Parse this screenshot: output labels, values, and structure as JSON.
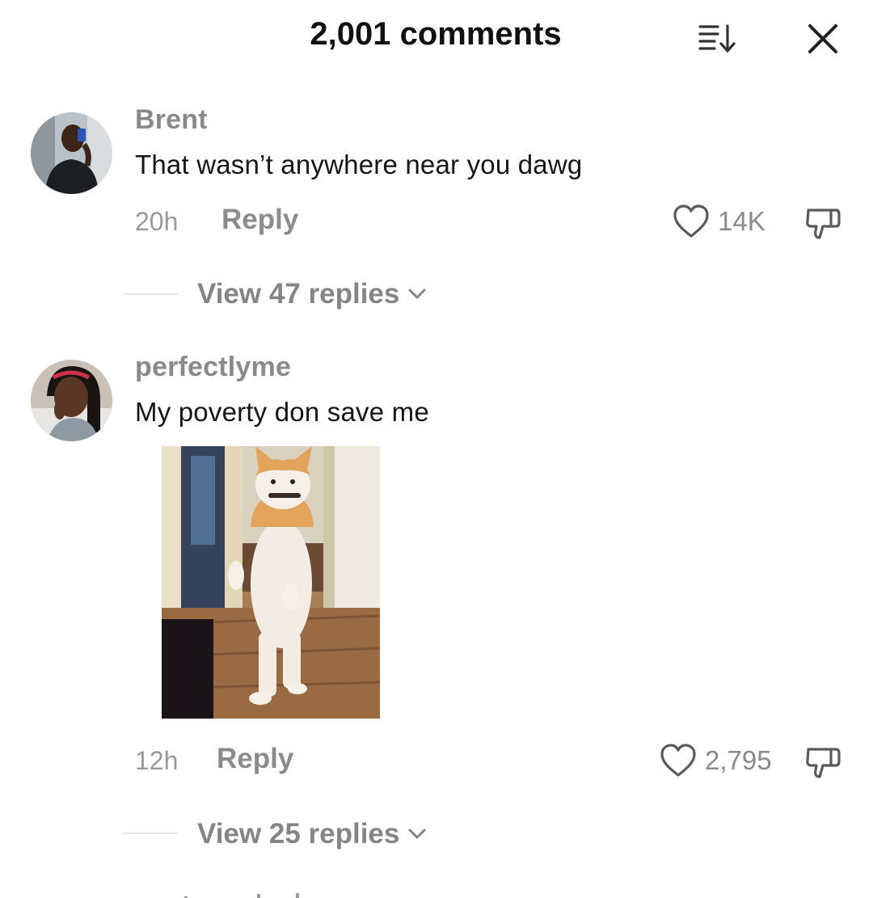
{
  "header": {
    "title": "2,001 comments",
    "sort_icon": "sort-descending-icon",
    "close_icon": "close-icon"
  },
  "comments": [
    {
      "username": "Brent",
      "text": "That wasn’t anywhere near you dawg",
      "time": "20h",
      "reply_label": "Reply",
      "like_count": "14K",
      "view_replies": "View 47 replies",
      "avatar": "avatar-photo"
    },
    {
      "username": "perfectlyme",
      "text": "My poverty don save me",
      "time": "12h",
      "reply_label": "Reply",
      "like_count": "2,795",
      "view_replies": "View 25 replies",
      "avatar": "avatar-photo",
      "attachment": "standing-cat-gif"
    }
  ],
  "colors": {
    "title": "#111111",
    "username": "#8a8a8a",
    "text": "#161616",
    "meta": "#9a9a9a",
    "icon": "#5a5a5a"
  }
}
